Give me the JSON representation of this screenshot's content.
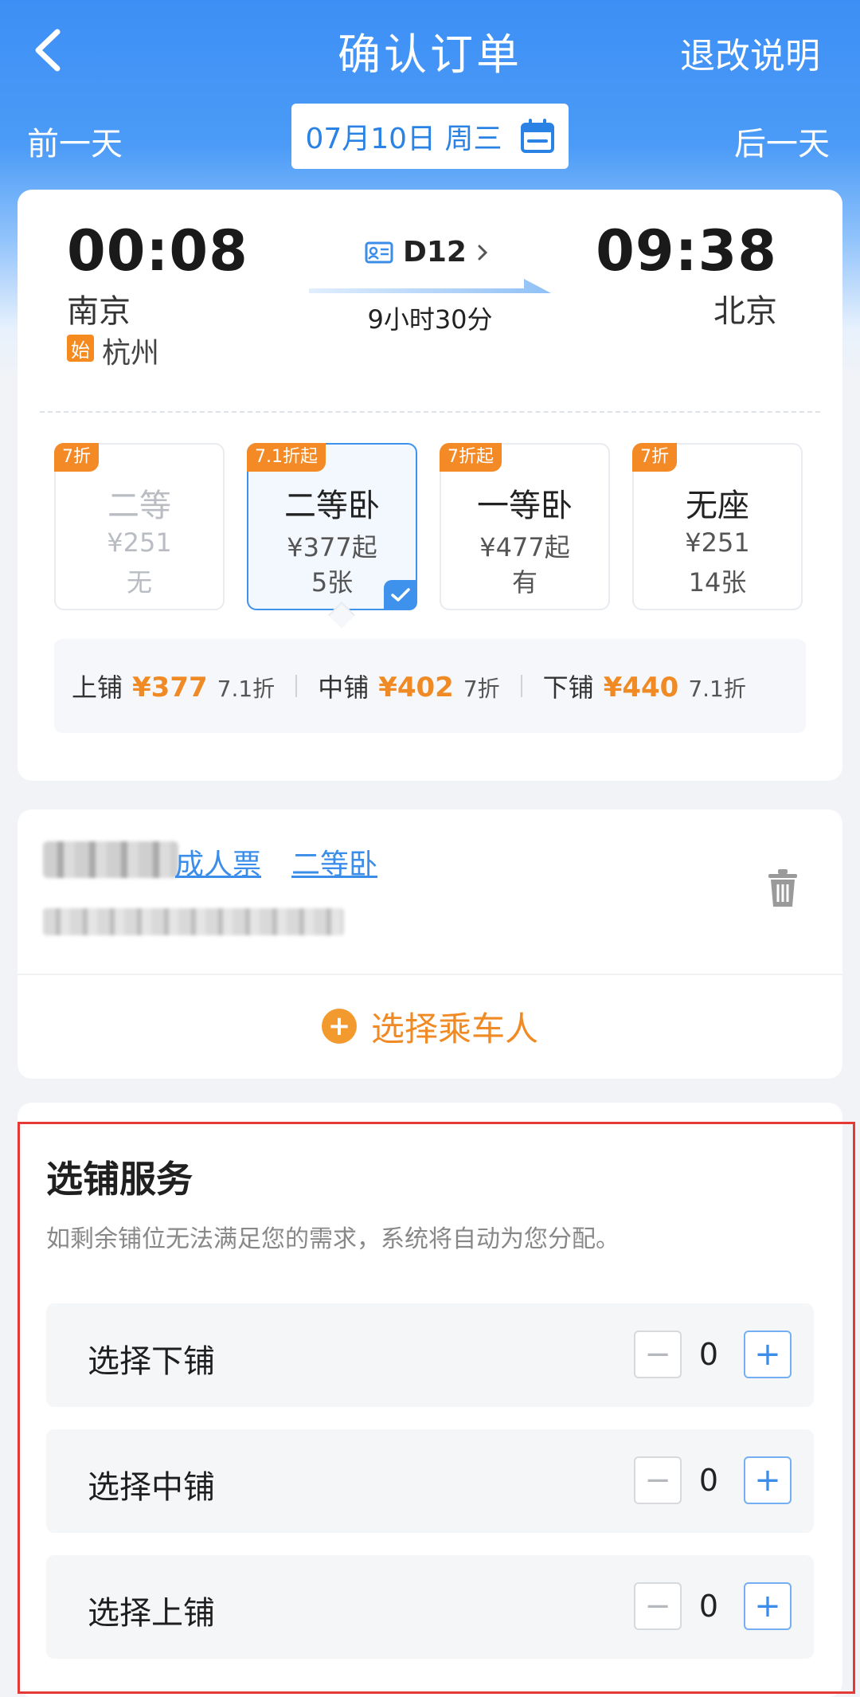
{
  "header": {
    "title": "确认订单",
    "right_link": "退改说明"
  },
  "date_bar": {
    "prev": "前一天",
    "date": "07月10日 周三",
    "next": "后一天"
  },
  "trip": {
    "depart_time": "00:08",
    "depart_city": "南京",
    "origin_badge": "始",
    "origin_city": "杭州",
    "train_no": "D12",
    "duration": "9小时30分",
    "arrive_time": "09:38",
    "arrive_city": "北京"
  },
  "seats": [
    {
      "tag": "7折",
      "name": "二等",
      "price": "¥251",
      "count": "无"
    },
    {
      "tag": "7.1折起",
      "name": "二等卧",
      "price": "¥377起",
      "count": "5张"
    },
    {
      "tag": "7折起",
      "name": "一等卧",
      "price": "¥477起",
      "count": "有"
    },
    {
      "tag": "7折",
      "name": "无座",
      "price": "¥251",
      "count": "14张"
    }
  ],
  "berths": [
    {
      "label": "上铺",
      "price": "¥377",
      "discount": "7.1折"
    },
    {
      "label": "中铺",
      "price": "¥402",
      "discount": "7折"
    },
    {
      "label": "下铺",
      "price": "¥440",
      "discount": "7.1折"
    }
  ],
  "passenger": {
    "ticket_type": "成人票",
    "seat_type": "二等卧",
    "choose_label": "选择乘车人"
  },
  "berth_service": {
    "title": "选铺服务",
    "desc": "如剩余铺位无法满足您的需求，系统将自动为您分配。",
    "rows": [
      {
        "label": "选择下铺",
        "value": "0"
      },
      {
        "label": "选择中铺",
        "value": "0"
      },
      {
        "label": "选择上铺",
        "value": "0"
      }
    ],
    "minus": "−",
    "plus": "+"
  },
  "colors": {
    "primary": "#3b8dea",
    "accent": "#f08a24",
    "highlight": "#e53935"
  },
  "icons": [
    "back-arrow-icon",
    "calendar-icon",
    "id-card-icon",
    "chevron-right-icon",
    "checkmark-icon",
    "trash-icon",
    "plus-circle-icon"
  ]
}
